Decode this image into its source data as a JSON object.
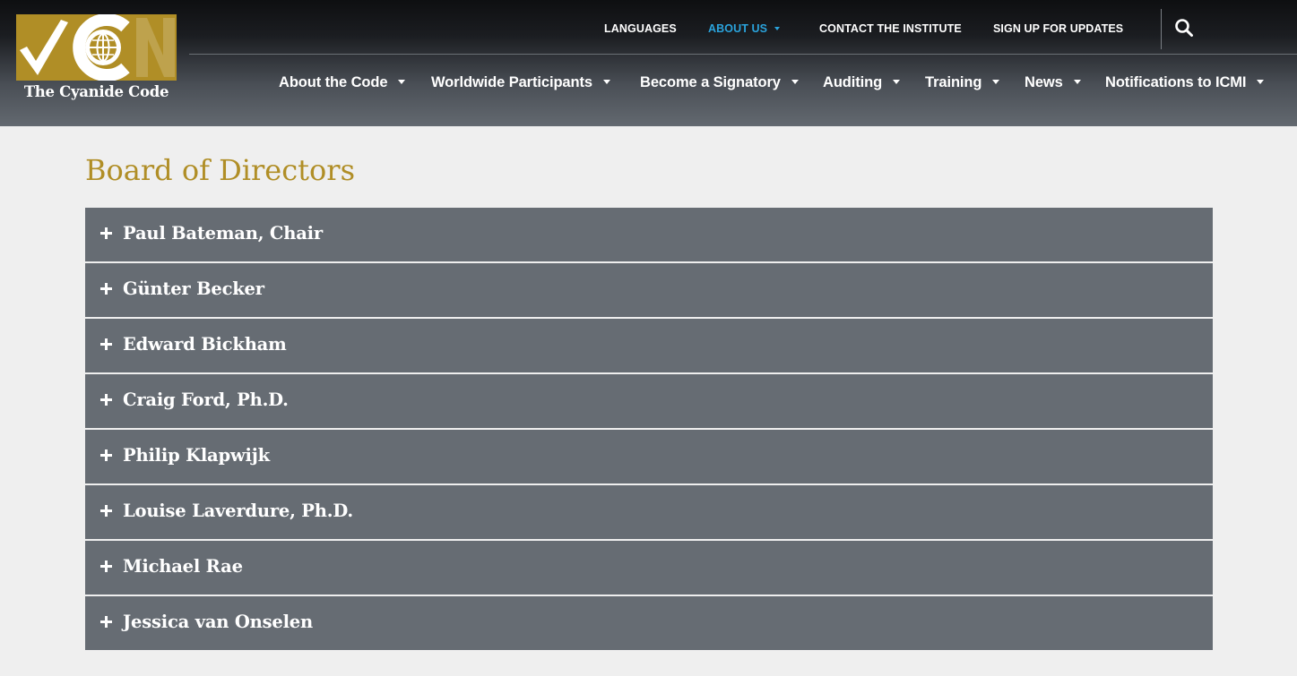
{
  "brand": {
    "logo_text": "The Cyanide Code",
    "gold": "#b08e26",
    "accent_blue": "#2aa3dc",
    "accordion_bg": "#666c73"
  },
  "top_nav": {
    "languages": "LANGUAGES",
    "about_us": "ABOUT US",
    "contact": "CONTACT THE INSTITUTE",
    "signup": "SIGN UP FOR UPDATES",
    "search_icon": "search-icon"
  },
  "main_nav": {
    "about_code": "About the Code",
    "worldwide": "Worldwide Participants",
    "signatory": "Become a Signatory",
    "auditing": "Auditing",
    "training": "Training",
    "news": "News",
    "notifications": "Notifications to ICMI"
  },
  "page": {
    "title": "Board of Directors"
  },
  "directors": [
    "Paul Bateman, Chair",
    "Günter Becker",
    "Edward Bickham",
    "Craig Ford, Ph.D.",
    "Philip Klapwijk",
    "Louise Laverdure, Ph.D.",
    "Michael Rae",
    "Jessica van Onselen"
  ]
}
